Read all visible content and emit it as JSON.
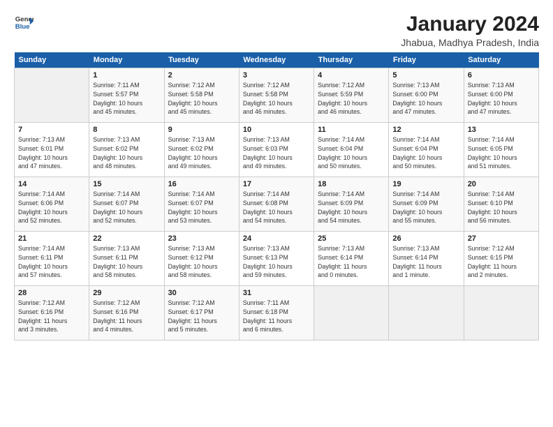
{
  "header": {
    "logo_line1": "General",
    "logo_line2": "Blue",
    "title": "January 2024",
    "subtitle": "Jhabua, Madhya Pradesh, India"
  },
  "days_of_week": [
    "Sunday",
    "Monday",
    "Tuesday",
    "Wednesday",
    "Thursday",
    "Friday",
    "Saturday"
  ],
  "weeks": [
    [
      {
        "day": "",
        "info": ""
      },
      {
        "day": "1",
        "info": "Sunrise: 7:11 AM\nSunset: 5:57 PM\nDaylight: 10 hours\nand 45 minutes."
      },
      {
        "day": "2",
        "info": "Sunrise: 7:12 AM\nSunset: 5:58 PM\nDaylight: 10 hours\nand 45 minutes."
      },
      {
        "day": "3",
        "info": "Sunrise: 7:12 AM\nSunset: 5:58 PM\nDaylight: 10 hours\nand 46 minutes."
      },
      {
        "day": "4",
        "info": "Sunrise: 7:12 AM\nSunset: 5:59 PM\nDaylight: 10 hours\nand 46 minutes."
      },
      {
        "day": "5",
        "info": "Sunrise: 7:13 AM\nSunset: 6:00 PM\nDaylight: 10 hours\nand 47 minutes."
      },
      {
        "day": "6",
        "info": "Sunrise: 7:13 AM\nSunset: 6:00 PM\nDaylight: 10 hours\nand 47 minutes."
      }
    ],
    [
      {
        "day": "7",
        "info": "Sunrise: 7:13 AM\nSunset: 6:01 PM\nDaylight: 10 hours\nand 47 minutes."
      },
      {
        "day": "8",
        "info": "Sunrise: 7:13 AM\nSunset: 6:02 PM\nDaylight: 10 hours\nand 48 minutes."
      },
      {
        "day": "9",
        "info": "Sunrise: 7:13 AM\nSunset: 6:02 PM\nDaylight: 10 hours\nand 49 minutes."
      },
      {
        "day": "10",
        "info": "Sunrise: 7:13 AM\nSunset: 6:03 PM\nDaylight: 10 hours\nand 49 minutes."
      },
      {
        "day": "11",
        "info": "Sunrise: 7:14 AM\nSunset: 6:04 PM\nDaylight: 10 hours\nand 50 minutes."
      },
      {
        "day": "12",
        "info": "Sunrise: 7:14 AM\nSunset: 6:04 PM\nDaylight: 10 hours\nand 50 minutes."
      },
      {
        "day": "13",
        "info": "Sunrise: 7:14 AM\nSunset: 6:05 PM\nDaylight: 10 hours\nand 51 minutes."
      }
    ],
    [
      {
        "day": "14",
        "info": "Sunrise: 7:14 AM\nSunset: 6:06 PM\nDaylight: 10 hours\nand 52 minutes."
      },
      {
        "day": "15",
        "info": "Sunrise: 7:14 AM\nSunset: 6:07 PM\nDaylight: 10 hours\nand 52 minutes."
      },
      {
        "day": "16",
        "info": "Sunrise: 7:14 AM\nSunset: 6:07 PM\nDaylight: 10 hours\nand 53 minutes."
      },
      {
        "day": "17",
        "info": "Sunrise: 7:14 AM\nSunset: 6:08 PM\nDaylight: 10 hours\nand 54 minutes."
      },
      {
        "day": "18",
        "info": "Sunrise: 7:14 AM\nSunset: 6:09 PM\nDaylight: 10 hours\nand 54 minutes."
      },
      {
        "day": "19",
        "info": "Sunrise: 7:14 AM\nSunset: 6:09 PM\nDaylight: 10 hours\nand 55 minutes."
      },
      {
        "day": "20",
        "info": "Sunrise: 7:14 AM\nSunset: 6:10 PM\nDaylight: 10 hours\nand 56 minutes."
      }
    ],
    [
      {
        "day": "21",
        "info": "Sunrise: 7:14 AM\nSunset: 6:11 PM\nDaylight: 10 hours\nand 57 minutes."
      },
      {
        "day": "22",
        "info": "Sunrise: 7:13 AM\nSunset: 6:11 PM\nDaylight: 10 hours\nand 58 minutes."
      },
      {
        "day": "23",
        "info": "Sunrise: 7:13 AM\nSunset: 6:12 PM\nDaylight: 10 hours\nand 58 minutes."
      },
      {
        "day": "24",
        "info": "Sunrise: 7:13 AM\nSunset: 6:13 PM\nDaylight: 10 hours\nand 59 minutes."
      },
      {
        "day": "25",
        "info": "Sunrise: 7:13 AM\nSunset: 6:14 PM\nDaylight: 11 hours\nand 0 minutes."
      },
      {
        "day": "26",
        "info": "Sunrise: 7:13 AM\nSunset: 6:14 PM\nDaylight: 11 hours\nand 1 minute."
      },
      {
        "day": "27",
        "info": "Sunrise: 7:12 AM\nSunset: 6:15 PM\nDaylight: 11 hours\nand 2 minutes."
      }
    ],
    [
      {
        "day": "28",
        "info": "Sunrise: 7:12 AM\nSunset: 6:16 PM\nDaylight: 11 hours\nand 3 minutes."
      },
      {
        "day": "29",
        "info": "Sunrise: 7:12 AM\nSunset: 6:16 PM\nDaylight: 11 hours\nand 4 minutes."
      },
      {
        "day": "30",
        "info": "Sunrise: 7:12 AM\nSunset: 6:17 PM\nDaylight: 11 hours\nand 5 minutes."
      },
      {
        "day": "31",
        "info": "Sunrise: 7:11 AM\nSunset: 6:18 PM\nDaylight: 11 hours\nand 6 minutes."
      },
      {
        "day": "",
        "info": ""
      },
      {
        "day": "",
        "info": ""
      },
      {
        "day": "",
        "info": ""
      }
    ]
  ]
}
